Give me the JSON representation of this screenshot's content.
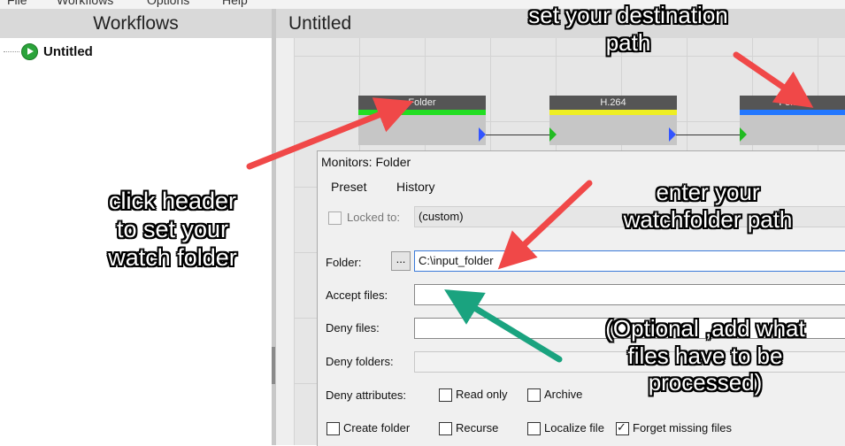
{
  "menu": [
    "File",
    "Workflows",
    "Options",
    "Help"
  ],
  "left_pane": {
    "title": "Workflows",
    "tree_item": "Untitled"
  },
  "right_pane": {
    "title": "Untitled"
  },
  "nodes": [
    {
      "title": "Folder",
      "bar_color": "#22dd22"
    },
    {
      "title": "H.264",
      "bar_color": "#eeee22"
    },
    {
      "title": "Folder",
      "bar_color": "#2277ff"
    }
  ],
  "dialog": {
    "title": "Monitors: Folder",
    "menu": [
      "Preset",
      "History"
    ],
    "locked_to_label": "Locked to:",
    "locked_to_value": "(custom)",
    "folder_label": "Folder:",
    "browse_label": "...",
    "folder_value": "C:\\input_folder",
    "accept_files_label": "Accept files:",
    "accept_files_value": "",
    "deny_files_label": "Deny files:",
    "deny_folders_label": "Deny folders:",
    "deny_attributes_label": "Deny attributes:",
    "attr_read_only": "Read only",
    "attr_archive": "Archive",
    "opt_create_folder": "Create folder",
    "opt_recurse": "Recurse",
    "opt_localize_file": "Localize file",
    "opt_forget_missing": "Forget missing files",
    "forget_missing_checked": true
  },
  "annotations": {
    "destination": "set your destination path",
    "watch_header": "click header to set your watch folder",
    "watchfolder_path": "enter your watchfolder path",
    "optional": "(Optional ,add what files have to be processed)"
  },
  "colors": {
    "arrow_red": "#f04848",
    "arrow_teal": "#1aa37f"
  }
}
